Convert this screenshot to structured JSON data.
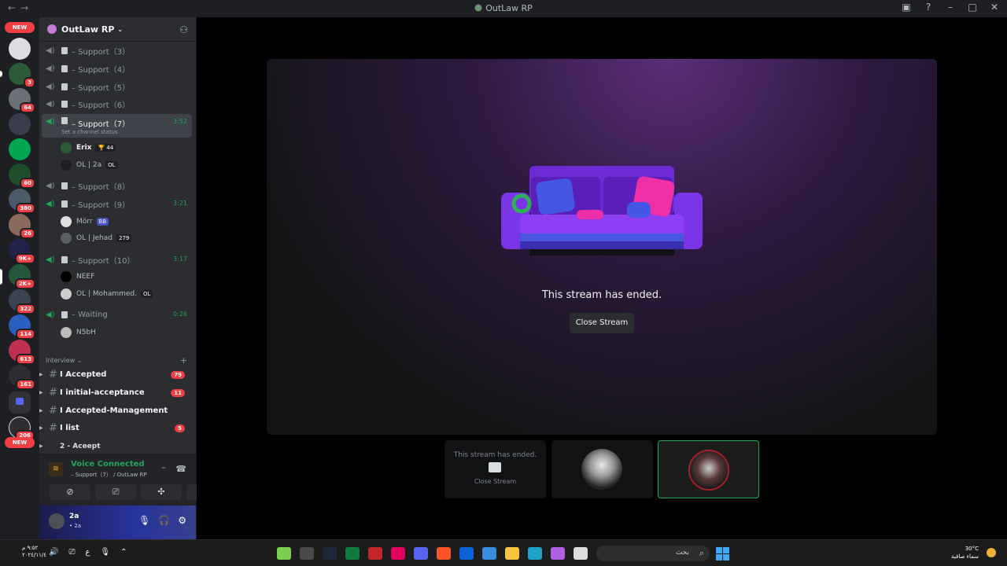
{
  "window": {
    "title": "OutLaw RP",
    "nav_back": "←",
    "nav_forward": "→"
  },
  "rail": {
    "new_label": "NEW",
    "badges": [
      "3",
      "64",
      "60",
      "380",
      "26",
      "9K+",
      "2K+",
      "322",
      "114",
      "613",
      "161",
      "206"
    ]
  },
  "server": {
    "name": "OutLaw RP"
  },
  "voice_channels": [
    {
      "label": "– Support（3）"
    },
    {
      "label": "– Support（4）"
    },
    {
      "label": "– Support（5）"
    },
    {
      "label": "– Support（6）"
    },
    {
      "label": "– Support（7）",
      "time": "3:52",
      "status": "Set a channel status"
    },
    {
      "label": "– Support（8）"
    },
    {
      "label": "– Support（9）",
      "time": "3:21"
    },
    {
      "label": "– Support（10）",
      "time": "3:17"
    },
    {
      "label": "– Waiting",
      "time": "0:26"
    }
  ],
  "voice_users": [
    {
      "name": "Erix",
      "tag": "🏆 44"
    },
    {
      "name": "OL | 2a",
      "tag": "OL"
    },
    {
      "name": "Mörr",
      "tag": "BB"
    },
    {
      "name": "OL | Jehad",
      "tag": "279"
    },
    {
      "name": "NEEF",
      "tag": ""
    },
    {
      "name": "OL | Mohammed.",
      "tag": "OL"
    },
    {
      "name": "N5bH",
      "tag": ""
    }
  ],
  "category": {
    "name": "Interview",
    "add": "+"
  },
  "text_channels": [
    {
      "label": "I Accepted",
      "count": "79"
    },
    {
      "label": "I initial-acceptance",
      "count": "11"
    },
    {
      "label": "I Accepted-Management",
      "count": ""
    },
    {
      "label": "I list",
      "count": "5"
    },
    {
      "label": "2 - Aceept",
      "count": ""
    }
  ],
  "voice_panel": {
    "status": "Voice Connected",
    "location": "– Support（7） / OutLaw RP"
  },
  "user": {
    "name": "2a",
    "sub": "• 2a"
  },
  "stage": {
    "ended_text": "This stream has ended.",
    "close_button": "Close Stream"
  },
  "tiles": [
    {
      "ended": "This stream has ended.",
      "close": "Close Stream"
    }
  ],
  "taskbar": {
    "clock_time": "٩:٥٢ م",
    "clock_date": "٢٠٢٤/١١/٤",
    "lang": "ع",
    "search_label": "بحث",
    "temperature": "30°C",
    "weather": "سماء صافية"
  },
  "colors": {
    "online_green": "#23a55a",
    "notification_red": "#f23f43",
    "sidebar_bg": "#2b2d31"
  }
}
